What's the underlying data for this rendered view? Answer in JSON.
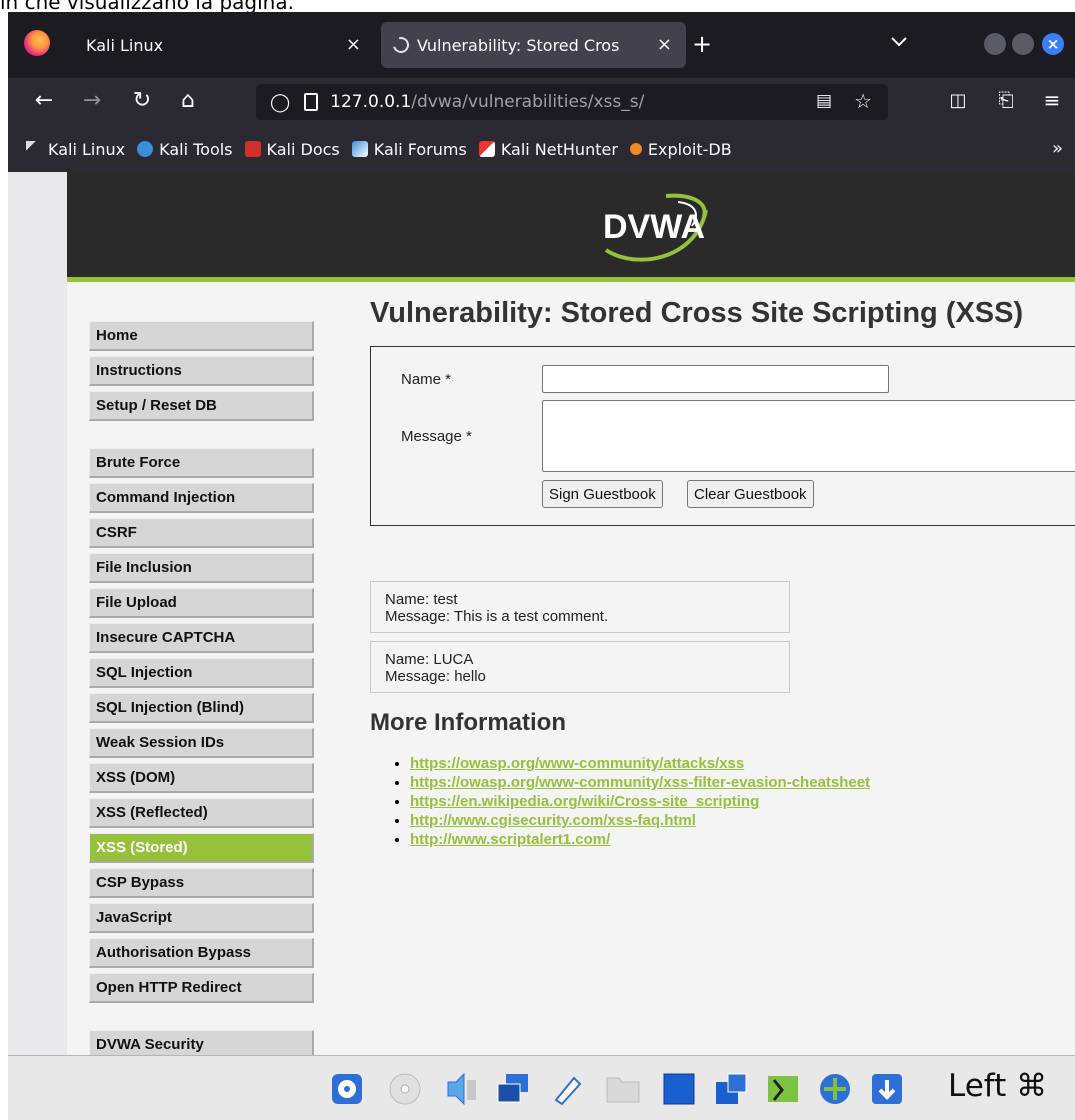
{
  "caption": "in che visualizzano la pagina.",
  "browser": {
    "tabs": [
      {
        "title": "Kali Linux"
      },
      {
        "title": "Vulnerability: Stored Cros"
      }
    ],
    "close_glyph": "×",
    "new_tab_glyph": "+",
    "url_host": "127.0.0.1",
    "url_path": "/dvwa/vulnerabilities/xss_s/",
    "bookmarks": [
      "Kali Linux",
      "Kali Tools",
      "Kali Docs",
      "Kali Forums",
      "Kali NetHunter",
      "Exploit-DB"
    ],
    "more_glyph": "»"
  },
  "dvwa": {
    "logo_text": "DVWA",
    "menu_groups": [
      [
        "Home",
        "Instructions",
        "Setup / Reset DB"
      ],
      [
        "Brute Force",
        "Command Injection",
        "CSRF",
        "File Inclusion",
        "File Upload",
        "Insecure CAPTCHA",
        "SQL Injection",
        "SQL Injection (Blind)",
        "Weak Session IDs",
        "XSS (DOM)",
        "XSS (Reflected)",
        "XSS (Stored)",
        "CSP Bypass",
        "JavaScript",
        "Authorisation Bypass",
        "Open HTTP Redirect"
      ],
      [
        "DVWA Security"
      ]
    ],
    "active_item": "XSS (Stored)",
    "accent": "#95c13b",
    "page_title": "Vulnerability: Stored Cross Site Scripting (XSS)",
    "form": {
      "name_label": "Name *",
      "message_label": "Message *",
      "name_value": "",
      "message_value": "",
      "sign_button": "Sign Guestbook",
      "clear_button": "Clear Guestbook"
    },
    "entries": [
      {
        "name": "Name: test",
        "message": "Message: This is a test comment."
      },
      {
        "name": "Name: LUCA",
        "message": "Message: hello"
      }
    ],
    "more_info_title": "More Information",
    "links": [
      "https://owasp.org/www-community/attacks/xss",
      "https://owasp.org/www-community/xss-filter-evasion-cheatsheet",
      "https://en.wikipedia.org/wiki/Cross-site_scripting",
      "http://www.cgisecurity.com/xss-faq.html",
      "http://www.scriptalert1.com/"
    ]
  },
  "taskbar": {
    "host_key": "Left ⌘",
    "icons": [
      "hard-disk-icon",
      "optical-drive-icon",
      "audio-icon",
      "network-icon",
      "usb-icon",
      "shared-folder-icon",
      "display-icon",
      "screen-capture-icon",
      "recording-icon",
      "cpu-icon",
      "mouse-integration-icon",
      "download-icon"
    ]
  }
}
